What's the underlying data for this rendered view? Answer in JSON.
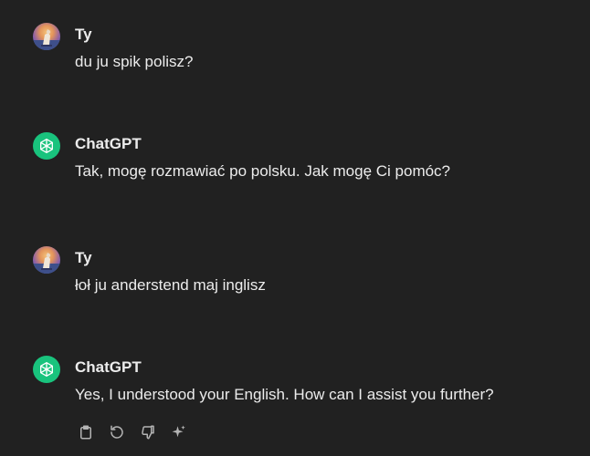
{
  "messages": [
    {
      "author": "Ty",
      "text": "du ju spik polisz?"
    },
    {
      "author": "ChatGPT",
      "text": "Tak, mogę rozmawiać po polsku. Jak mogę Ci pomóc?"
    },
    {
      "author": "Ty",
      "text": "łoł ju anderstend maj inglisz"
    },
    {
      "author": "ChatGPT",
      "text": "Yes, I understood your English. How can I assist you further?"
    }
  ],
  "actions": {
    "icons": [
      "copy-icon",
      "regenerate-icon",
      "thumbs-down-icon",
      "sparkle-icon"
    ]
  },
  "colors": {
    "background": "#212121",
    "text": "#ececec",
    "gpt_avatar": "#19c37d",
    "icon": "#b4b4b4"
  }
}
